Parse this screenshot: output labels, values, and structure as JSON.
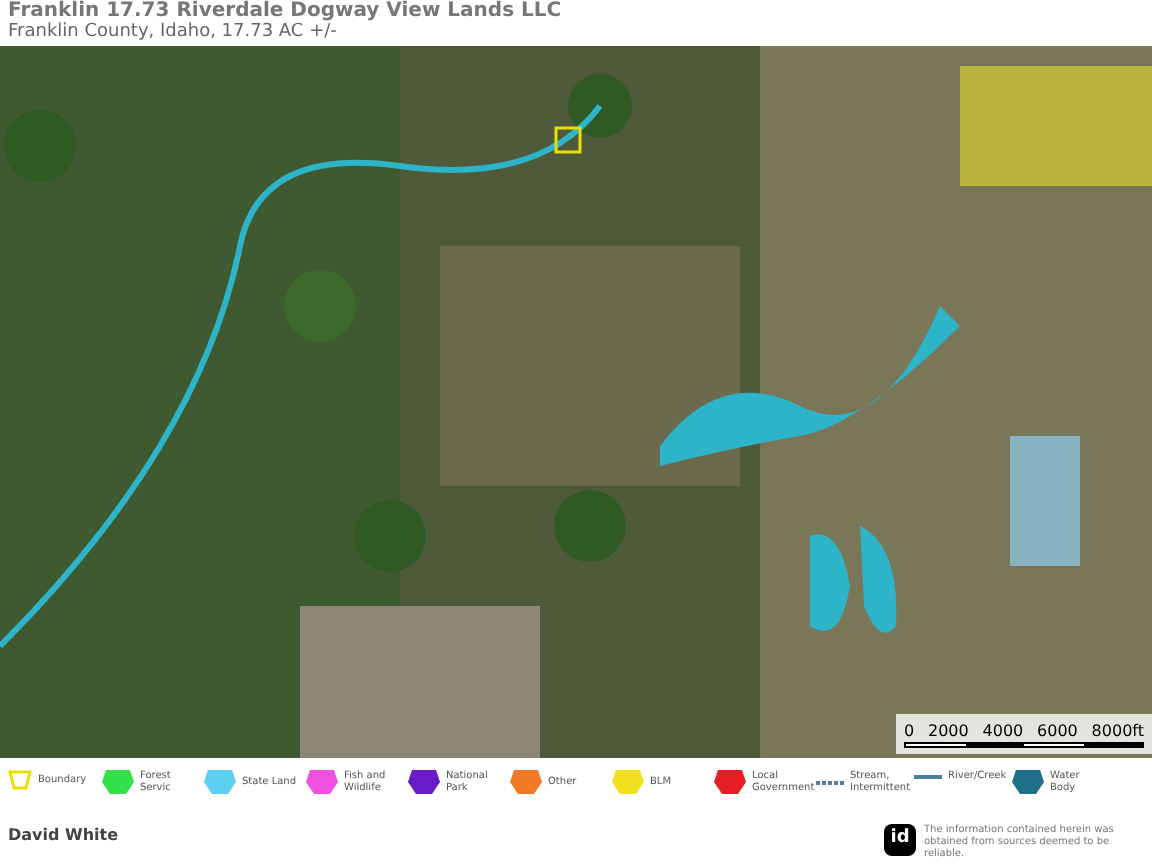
{
  "header": {
    "title": "Franklin 17.73 Riverdale Dogway View Lands LLC",
    "subtitle": "Franklin County, Idaho, 17.73 AC +/-"
  },
  "scale_bar": {
    "ticks": [
      "0",
      "2000",
      "4000",
      "6000",
      "8000ft"
    ]
  },
  "legend": [
    {
      "label": "Boundary",
      "kind": "outline",
      "color": "#e8e000"
    },
    {
      "label": "Forest Servic",
      "kind": "area",
      "color": "#33e04a"
    },
    {
      "label": "State Land",
      "kind": "area",
      "color": "#5ccff0"
    },
    {
      "label": "Fish and Wildlife",
      "kind": "area",
      "color": "#f050e0"
    },
    {
      "label": "National Park",
      "kind": "area",
      "color": "#6a1bc8"
    },
    {
      "label": "Other",
      "kind": "area",
      "color": "#f07a25"
    },
    {
      "label": "BLM",
      "kind": "area",
      "color": "#f0e020"
    },
    {
      "label": "Local Government",
      "kind": "area",
      "color": "#e81c24"
    },
    {
      "label": "Stream, Intermittent",
      "kind": "dashed",
      "color": "#4a7fa0"
    },
    {
      "label": "River/Creek",
      "kind": "line",
      "color": "#4a7fa0"
    },
    {
      "label": "Water Body",
      "kind": "area",
      "color": "#1d6f8a"
    }
  ],
  "footer": {
    "name": "David White",
    "logo": "id",
    "disclaimer": "The information contained herein was obtained from sources deemed to be reliable."
  }
}
